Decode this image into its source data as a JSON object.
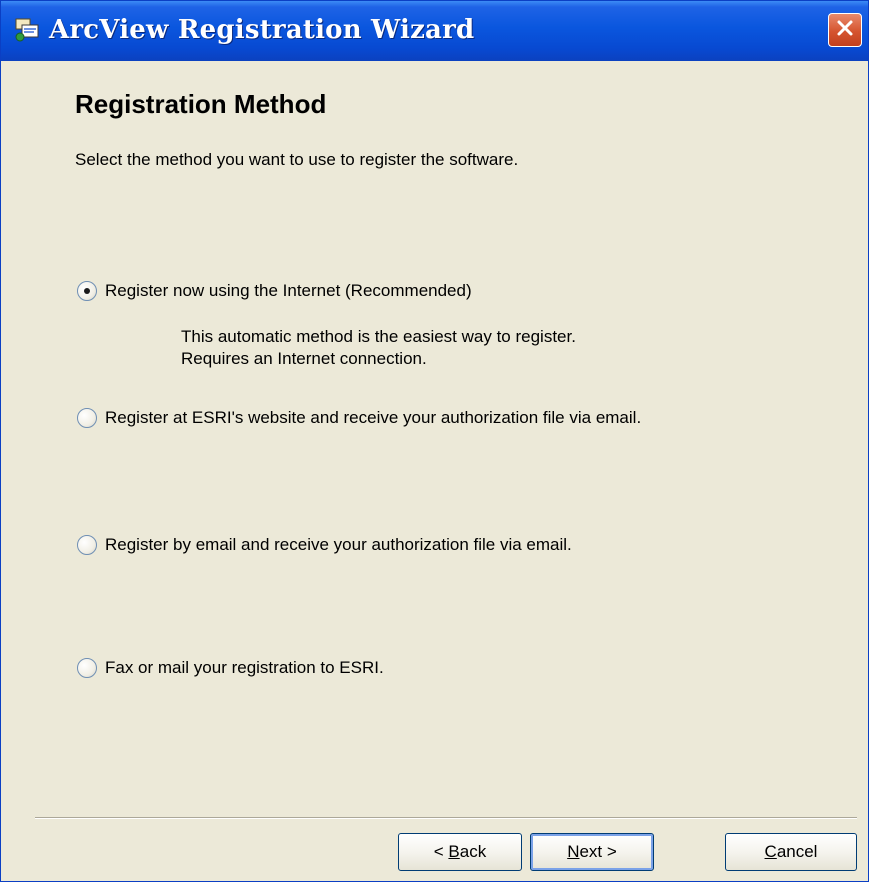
{
  "window": {
    "title": "ArcView Registration Wizard"
  },
  "page": {
    "heading": "Registration Method",
    "subtitle": "Select the method you want to use to register the software."
  },
  "options": [
    {
      "label": "Register now using the Internet (Recommended)",
      "selected": true
    },
    {
      "label": "Register at ESRI's website and receive your authorization file via email.",
      "selected": false
    },
    {
      "label": "Register by email and receive your authorization file via email.",
      "selected": false
    },
    {
      "label": "Fax or mail your registration to ESRI.",
      "selected": false
    }
  ],
  "option_description": {
    "line1": "This automatic method is the easiest way to register.",
    "line2": "Requires an Internet connection."
  },
  "buttons": {
    "back": {
      "prefix": "< ",
      "mnemonic": "B",
      "rest": "ack"
    },
    "next": {
      "mnemonic": "N",
      "rest": "ext >"
    },
    "cancel": {
      "mnemonic": "C",
      "rest": "ancel"
    }
  },
  "colors": {
    "titlebar": "#0a56de",
    "dialog_bg": "#ece9d8",
    "close_button": "#d5542f"
  },
  "icons": {
    "title": "registration-wizard-icon",
    "close": "close-icon"
  }
}
